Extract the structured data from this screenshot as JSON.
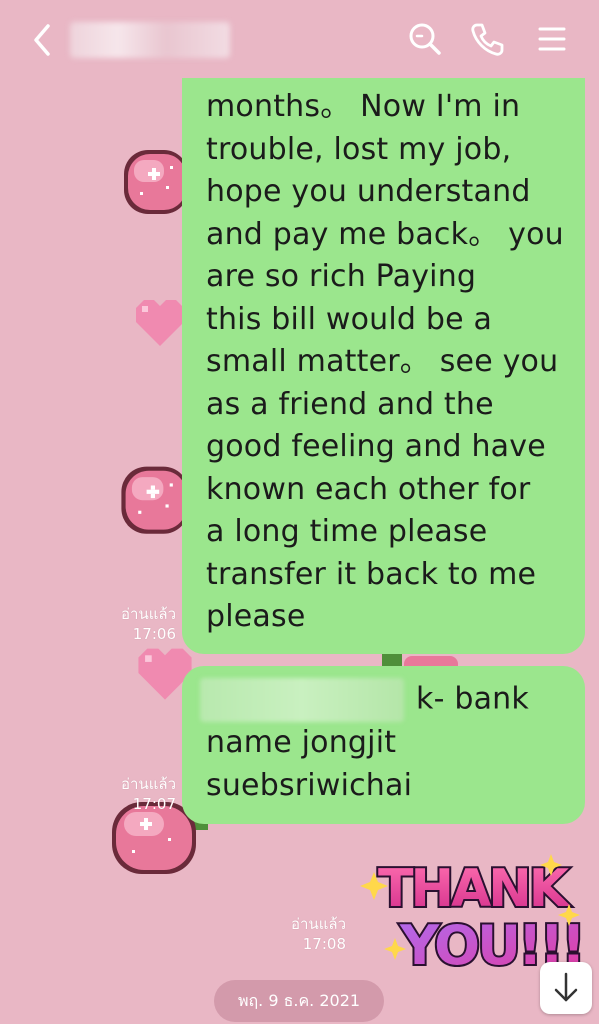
{
  "header": {
    "back_icon": "chevron-left-icon",
    "contact_name_blurred": true,
    "actions": [
      "search-icon",
      "phone-icon",
      "menu-icon"
    ]
  },
  "messages": [
    {
      "lines": [
        "months。 Now I'm in",
        "trouble, lost my job,",
        "hope you understand",
        "and pay me back。 you",
        "are so rich  Paying",
        "this bill would be a",
        "small matter。 see you",
        "as a friend  and the",
        "good feeling  and have",
        "known each other for",
        "a long time  please",
        "transfer it back to me",
        "please"
      ],
      "read": "อ่านแล้ว",
      "time": "17:06"
    },
    {
      "lines": [
        "k- bank",
        "name jongjit",
        "suebsriwichai"
      ],
      "read": "อ่านแล้ว",
      "time": "17:07"
    },
    {
      "sticker_text": "THANK YOU!!!",
      "read": "อ่านแล้ว",
      "time": "17:08"
    }
  ],
  "date_separator": "พฤ. 9 ธ.ค. 2021",
  "scroll_down_icon": "arrow-down-icon",
  "colors": {
    "background": "#e9b7c5",
    "bubble": "#9be68d",
    "date_pill": "#d39aab"
  }
}
